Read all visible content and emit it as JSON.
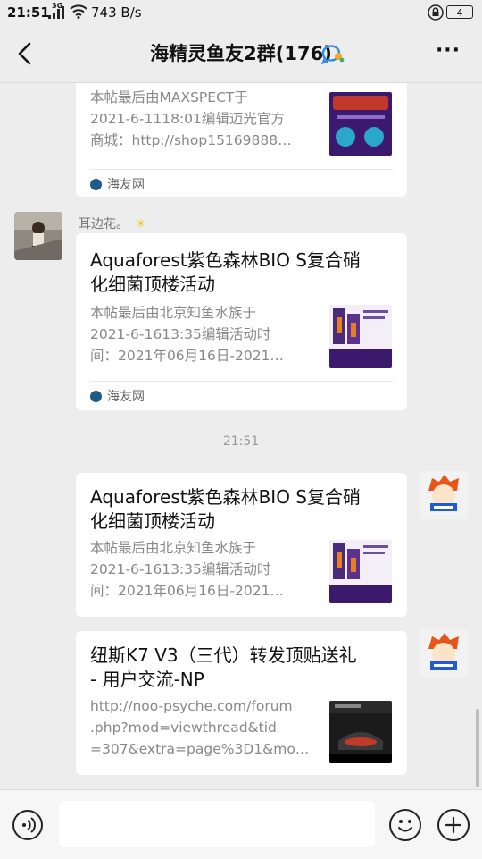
{
  "status_bar": {
    "time": "21:51",
    "network": "3G",
    "speed": "743 B/s",
    "battery": "4"
  },
  "header": {
    "title": "海精灵鱼友2群(176)",
    "back_icon": "back-chevron-icon",
    "more_icon": "more-dots-icon",
    "more_label": "···"
  },
  "messages": [
    {
      "type": "link_card",
      "side": "left",
      "desc": [
        "本帖最后由MAXSPECT于",
        "2021-6-1118:01编辑迈光官方",
        "商城：http://shop15169888…"
      ],
      "source": "海友网"
    },
    {
      "type": "link_card",
      "side": "left",
      "sender": "耳边花。",
      "sender_emoji": "☀",
      "title": [
        "Aquaforest紫色森林BIO S复合硝",
        "化细菌顶楼活动"
      ],
      "desc": [
        "本帖最后由北京知鱼水族于",
        "2021-6-1613:35编辑活动时",
        "间：2021年06月16日-2021…"
      ],
      "source": "海友网"
    },
    {
      "type": "timestamp",
      "text": "21:51"
    },
    {
      "type": "link_card",
      "side": "right",
      "title": [
        "Aquaforest紫色森林BIO S复合硝",
        "化细菌顶楼活动"
      ],
      "desc": [
        "本帖最后由北京知鱼水族于",
        "2021-6-1613:35编辑活动时",
        "间：2021年06月16日-2021…"
      ]
    },
    {
      "type": "link_card",
      "side": "right",
      "title": [
        "纽斯K7 V3（三代）转发顶贴送礼",
        "- 用户交流-NP"
      ],
      "desc": [
        "http://noo-psyche.com/forum",
        ".php?mod=viewthread&tid",
        "=307&extra=page%3D1&mo…"
      ]
    }
  ],
  "input_bar": {
    "placeholder": "",
    "voice_icon": "voice-icon",
    "emoji_icon": "emoji-icon",
    "plus_icon": "plus-icon"
  },
  "colors": {
    "background": "#ededed",
    "card": "#ffffff",
    "secondary_text": "#888888",
    "thumb_purple": "#3b1a6e"
  }
}
